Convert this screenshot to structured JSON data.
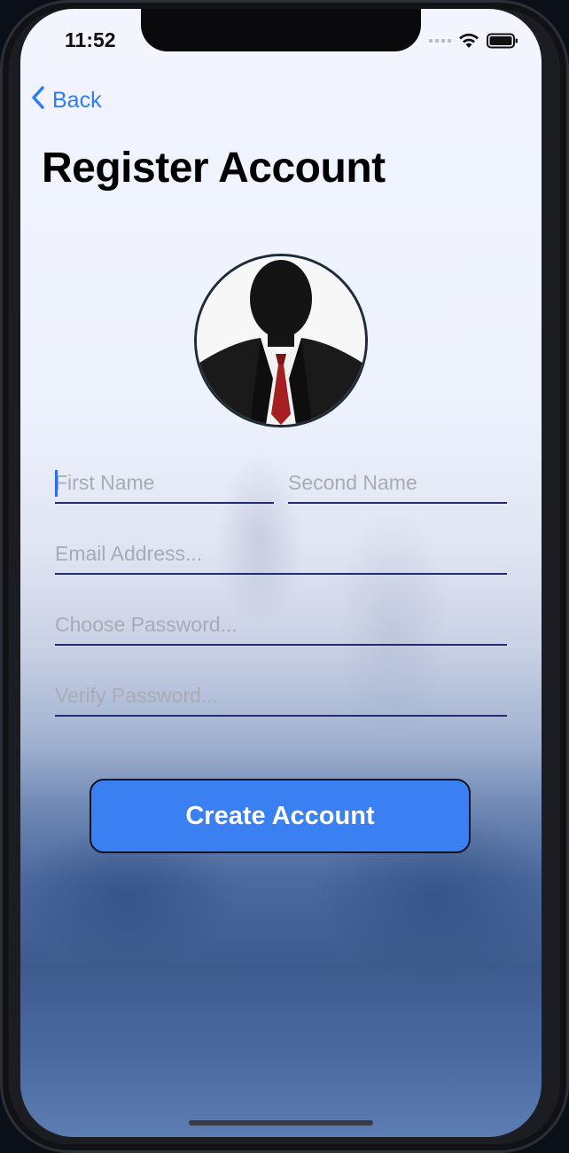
{
  "status_bar": {
    "time": "11:52"
  },
  "nav": {
    "back_label": "Back"
  },
  "page": {
    "title": "Register Account"
  },
  "form": {
    "first_name_placeholder": "First Name",
    "second_name_placeholder": "Second Name",
    "email_placeholder": "Email Address...",
    "password_placeholder": "Choose Password...",
    "verify_placeholder": "Verify Password..."
  },
  "actions": {
    "create_label": "Create Account"
  },
  "colors": {
    "accent": "#3a80f2",
    "underline": "#262a70",
    "placeholder": "#a8abb6"
  },
  "icons": {
    "back": "chevron-left-icon",
    "wifi": "wifi-icon",
    "battery": "battery-icon",
    "avatar": "person-silhouette-avatar"
  }
}
